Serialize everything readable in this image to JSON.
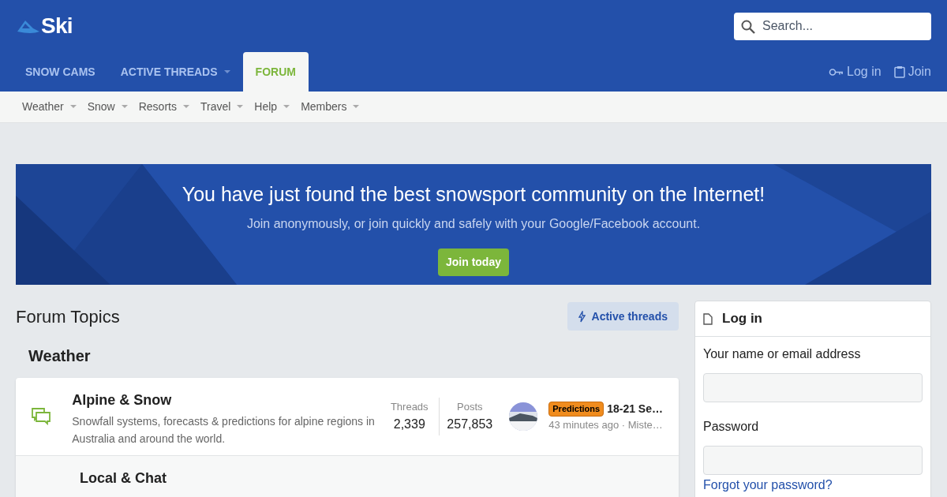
{
  "logo": {
    "text": "Ski"
  },
  "search": {
    "placeholder": "Search..."
  },
  "nav_tabs": [
    {
      "label": "SNOW CAMS",
      "selected": false,
      "dropdown": false
    },
    {
      "label": "ACTIVE THREADS",
      "selected": false,
      "dropdown": true
    },
    {
      "label": "FORUM",
      "selected": true,
      "dropdown": false
    }
  ],
  "account_links": [
    {
      "kind": "key",
      "label": "Log in"
    },
    {
      "kind": "clipboard",
      "label": "Join"
    }
  ],
  "sub_nav": [
    "Weather",
    "Snow",
    "Resorts",
    "Travel",
    "Help",
    "Members"
  ],
  "banner": {
    "title": "You have just found the best snowsport community on the Internet!",
    "subtitle": "Join anonymously, or join quickly and safely with your Google/Facebook account.",
    "button": "Join today"
  },
  "page_title": "Forum Topics",
  "active_threads_button": "Active threads",
  "section": "Weather",
  "forums": [
    {
      "title": "Alpine & Snow",
      "description": "Snowfall systems, forecasts & predictions for alpine regions in Australia and around the world.",
      "threads_label": "Threads",
      "threads": "2,339",
      "posts_label": "Posts",
      "posts": "257,853",
      "prefix": "Predictions",
      "color": "#f08c1e",
      "latest_title": "18-21 Se…",
      "latest_meta": "43 minutes ago · Miste…"
    },
    {
      "title": "Local & Chat"
    }
  ],
  "login_panel": {
    "title": "Log in",
    "fields": [
      {
        "label": "Your name or email address"
      },
      {
        "label": "Password"
      }
    ],
    "forgot_link": "Forgot your password?"
  }
}
